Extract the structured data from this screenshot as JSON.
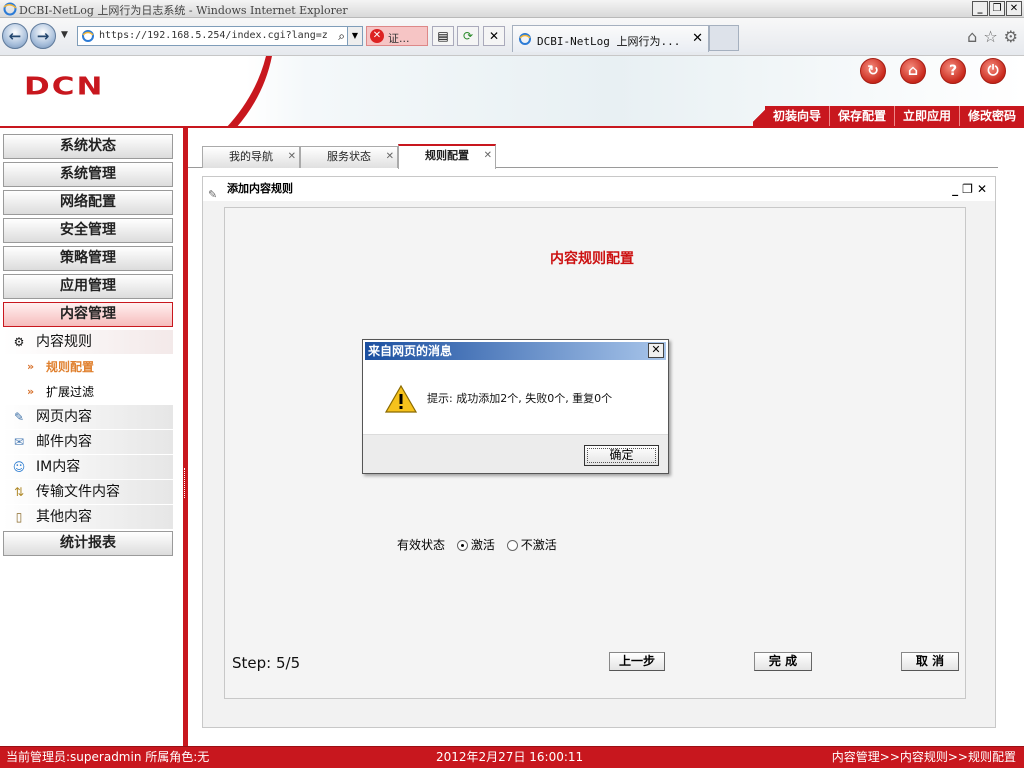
{
  "browser": {
    "window_title": "DCBI-NetLog 上网行为日志系统 - Windows Internet Explorer",
    "address": "https://192.168.5.254/index.cgi?lang=z",
    "cert_label": "证...",
    "tab_title": "DCBI-NetLog 上网行为...",
    "tab_close": "✕"
  },
  "header": {
    "logo": "DCN",
    "actions": [
      "初装向导",
      "保存配置",
      "立即应用",
      "修改密码"
    ]
  },
  "sidebar": {
    "menu": [
      "系统状态",
      "系统管理",
      "网络配置",
      "安全管理",
      "策略管理",
      "应用管理",
      "内容管理"
    ],
    "content_rule": "内容规则",
    "sub": [
      "规则配置",
      "扩展过滤"
    ],
    "items": [
      "网页内容",
      "邮件内容",
      "IM内容",
      "传输文件内容",
      "其他内容"
    ],
    "report": "统计报表"
  },
  "tabs": [
    {
      "label": "我的导航"
    },
    {
      "label": "服务状态"
    },
    {
      "label": "规则配置"
    }
  ],
  "panel": {
    "title": "添加内容规则",
    "config_title": "内容规则配置",
    "status_label": "有效状态",
    "radio_active": "激活",
    "radio_inactive": "不激活",
    "step": "Step: 5/5",
    "btn_prev": "上一步",
    "btn_finish": "完 成",
    "btn_cancel": "取 消"
  },
  "dialog": {
    "title": "来自网页的消息",
    "message": "提示: 成功添加2个, 失败0个, 重复0个",
    "ok": "确定"
  },
  "statusbar": {
    "user": "当前管理员:superadmin 所属角色:无",
    "datetime": "2012年2月27日 16:00:11",
    "breadcrumb": "内容管理>>内容规则>>规则配置"
  },
  "colors": {
    "brand_red": "#c8171e",
    "dialog_title_blue": "#1b4fa0",
    "config_title_red": "#cc1111"
  }
}
